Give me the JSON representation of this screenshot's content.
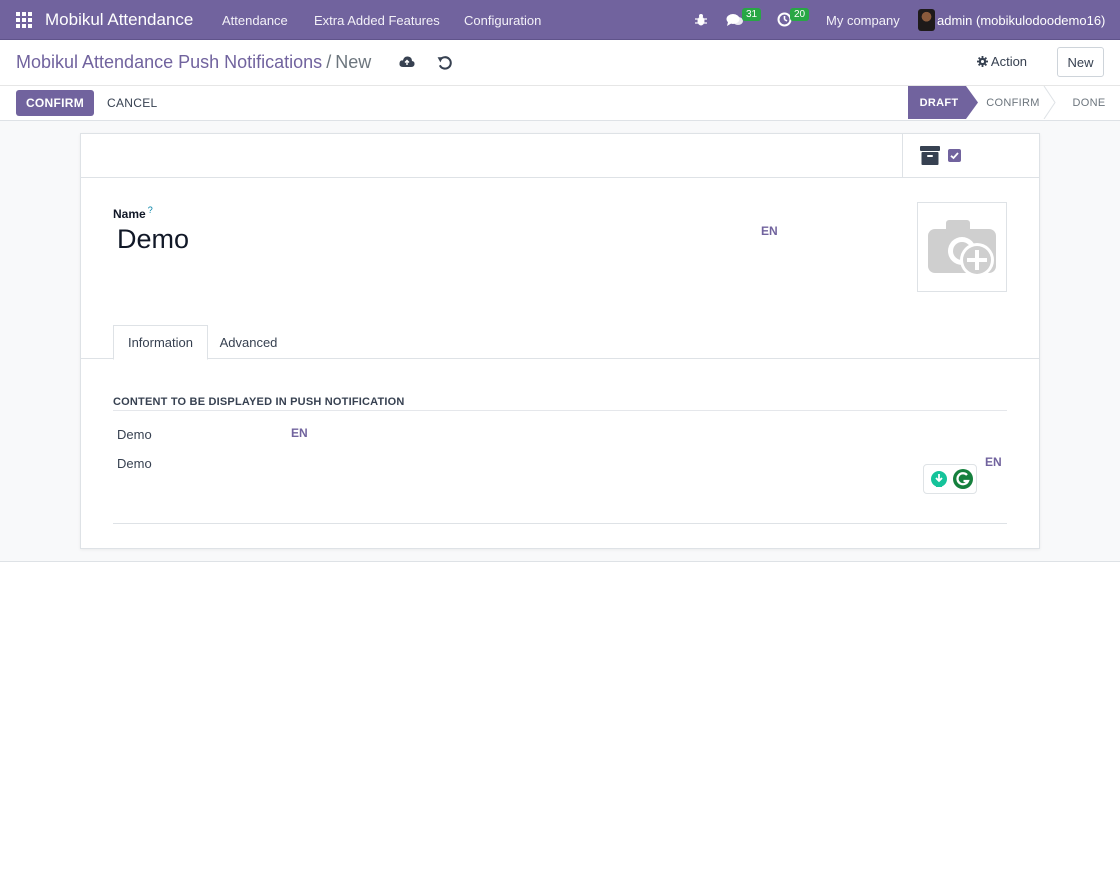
{
  "navbar": {
    "app_name": "Mobikul Attendance",
    "menu": [
      "Attendance",
      "Extra Added Features",
      "Configuration"
    ],
    "messages_count": "31",
    "activities_count": "20",
    "company": "My company",
    "user": "admin (mobikulodoodemo16)"
  },
  "breadcrumb": {
    "parent": "Mobikul Attendance Push Notifications",
    "separator": "/",
    "current": "New"
  },
  "control": {
    "action_label": "Action",
    "new_label": "New",
    "confirm_label": "CONFIRM",
    "cancel_label": "CANCEL"
  },
  "statusbar": {
    "stages": [
      "DRAFT",
      "CONFIRM",
      "DONE"
    ],
    "active": "DRAFT"
  },
  "form": {
    "name_label": "Name",
    "help_mark": "?",
    "name_value": "Demo",
    "lang": "EN",
    "tabs": [
      "Information",
      "Advanced"
    ],
    "section_title": "CONTENT TO BE DISPLAYED IN PUSH NOTIFICATION",
    "rows": [
      {
        "label": "Demo",
        "lang": "EN"
      },
      {
        "label": "Demo",
        "lang": "EN"
      }
    ]
  },
  "colors": {
    "brand": "#71639e",
    "badge": "#28a745"
  }
}
